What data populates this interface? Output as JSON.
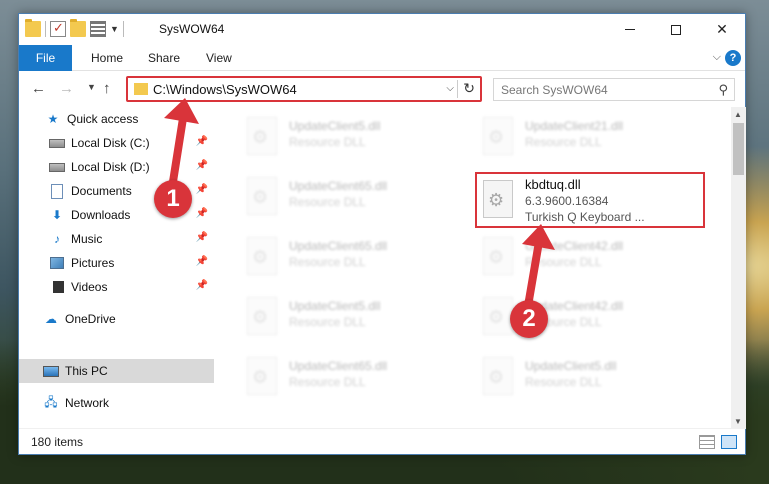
{
  "window": {
    "title": "SysWOW64"
  },
  "ribbon": {
    "tabs": [
      {
        "label": "File"
      },
      {
        "label": "Home"
      },
      {
        "label": "Share"
      },
      {
        "label": "View"
      }
    ]
  },
  "address": {
    "path": "C:\\Windows\\SysWOW64"
  },
  "search": {
    "placeholder": "Search SysWOW64"
  },
  "navpane": {
    "items": [
      {
        "label": "Quick access",
        "icon": "star-icon"
      },
      {
        "label": "Local Disk (C:)",
        "icon": "disk-icon",
        "pinned": true
      },
      {
        "label": "Local Disk (D:)",
        "icon": "disk-icon",
        "pinned": true
      },
      {
        "label": "Documents",
        "icon": "documents-icon",
        "pinned": true
      },
      {
        "label": "Downloads",
        "icon": "downloads-icon",
        "pinned": true
      },
      {
        "label": "Music",
        "icon": "music-icon",
        "pinned": true
      },
      {
        "label": "Pictures",
        "icon": "pictures-icon",
        "pinned": true
      },
      {
        "label": "Videos",
        "icon": "videos-icon",
        "pinned": true
      },
      {
        "label": "OneDrive",
        "icon": "onedrive-icon"
      },
      {
        "label": "This PC",
        "icon": "pc-icon",
        "selected": true
      },
      {
        "label": "Network",
        "icon": "network-icon"
      }
    ]
  },
  "files": {
    "row1": [
      {
        "name": "UpdateClient5.dll",
        "type": "Resource DLL"
      },
      {
        "name": "UpdateClient21.dll",
        "type": "Resource DLL"
      }
    ],
    "row2": [
      {
        "name": "UpdateClient65.dll",
        "type": "Resource DLL"
      },
      {
        "name": "kbdtuq.dll",
        "version": "6.3.9600.16384",
        "description": "Turkish Q Keyboard ..."
      }
    ],
    "row3": [
      {
        "name": "UpdateClient65.dll",
        "type": "Resource DLL"
      },
      {
        "name": "UpdateClient42.dll",
        "type": "Resource DLL"
      }
    ],
    "row4": [
      {
        "name": "UpdateClient5.dll",
        "type": "Resource DLL"
      },
      {
        "name": "UpdateClient42.dll",
        "type": "Resource DLL"
      }
    ],
    "row5": [
      {
        "name": "UpdateClient65.dll",
        "type": "Resource DLL"
      },
      {
        "name": "UpdateClient5.dll",
        "type": "Resource DLL"
      }
    ]
  },
  "status": {
    "item_count": "180 items"
  },
  "callouts": {
    "step1": "1",
    "step2": "2"
  },
  "colors": {
    "accent": "#1979ca",
    "highlight_red": "#d9343a",
    "folder_yellow": "#f3c94f"
  }
}
